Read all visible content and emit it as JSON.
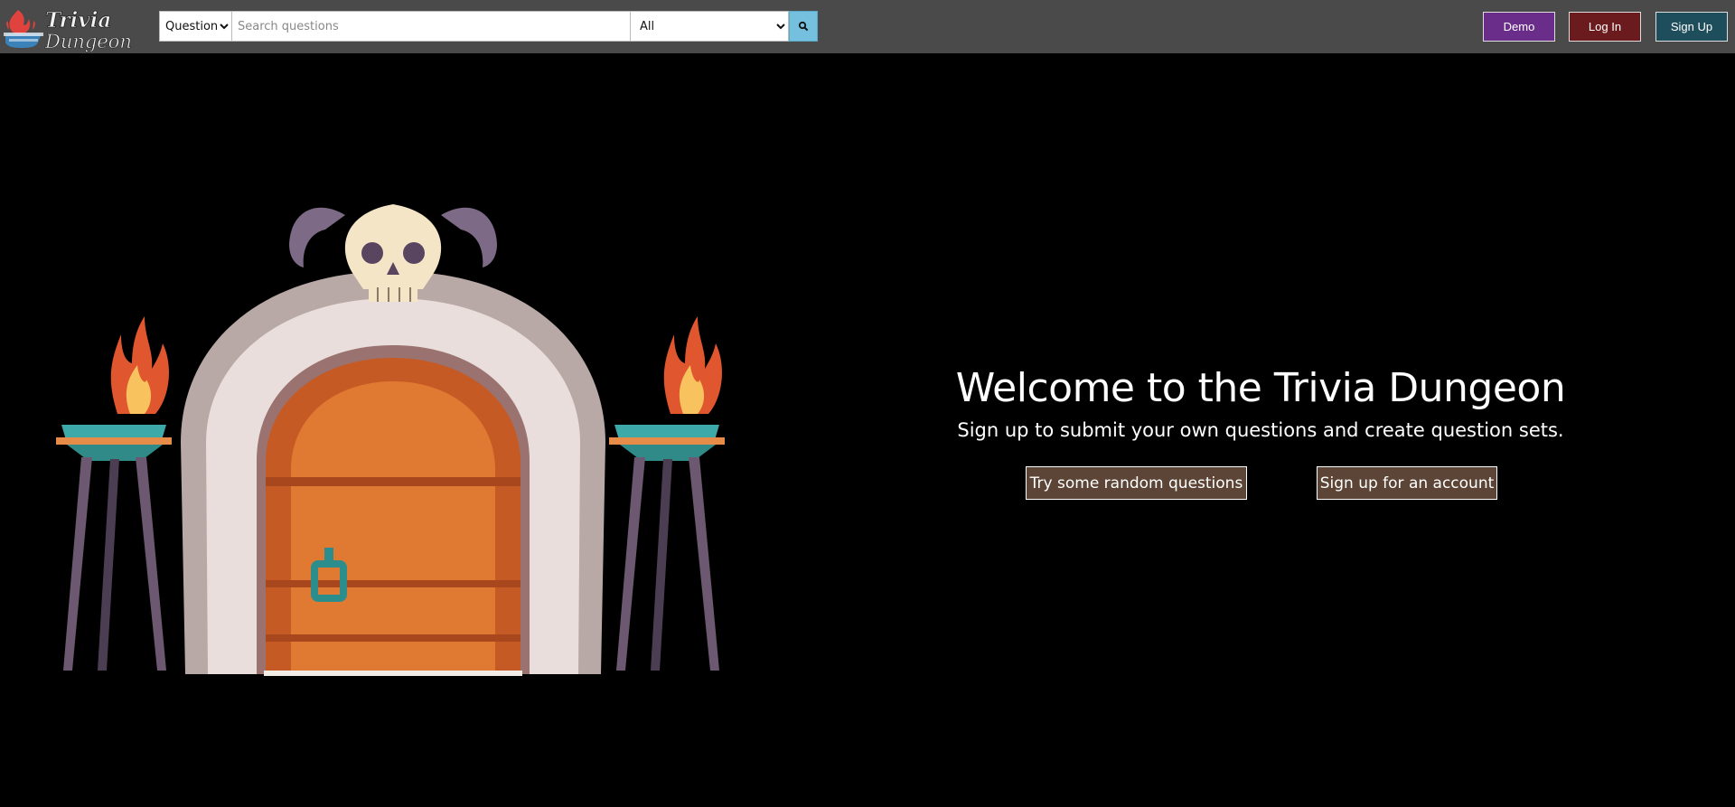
{
  "header": {
    "logo_text_line1": "Trivia",
    "logo_text_line2": "Dungeon",
    "search": {
      "type_selected": "Questions",
      "type_options": [
        "Questions"
      ],
      "placeholder": "Search questions",
      "value": "",
      "category_selected": "All",
      "category_options": [
        "All"
      ],
      "button_icon": "search-icon"
    },
    "buttons": {
      "demo": "Demo",
      "login": "Log In",
      "signup": "Sign Up"
    },
    "colors": {
      "navbar": "#4a4a4a",
      "demo": "#6a2e8a",
      "login": "#6b1b1e",
      "signup": "#1e4d5b",
      "search_button": "#74c0de"
    }
  },
  "hero": {
    "title": "Welcome to the Trivia Dungeon",
    "subtitle": "Sign up to submit your own questions and create question sets.",
    "buttons": {
      "random": "Try some random questions",
      "signup": "Sign up for an account"
    },
    "colors": {
      "cta_background": "#5c4536"
    }
  }
}
